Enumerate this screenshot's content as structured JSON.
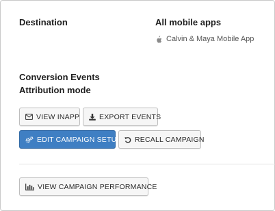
{
  "destination": {
    "label": "Destination",
    "apps_heading": "All mobile apps",
    "app_icon": "apple-icon",
    "app_name": "Calvin & Maya Mobile App"
  },
  "sections": {
    "conversion_events_label": "Conversion Events",
    "attribution_mode_label": "Attribution mode"
  },
  "actions": {
    "view_inapp": "VIEW INAPP",
    "export_events": "EXPORT EVENTS",
    "edit_campaign_setup": "EDIT CAMPAIGN SETUP",
    "recall_campaign": "RECALL CAMPAIGN",
    "view_campaign_performance": "VIEW CAMPAIGN PERFORMANCE"
  },
  "colors": {
    "primary": "#3f7fc3",
    "button_bg": "#f6f6f6",
    "border": "#bdbdbd"
  }
}
